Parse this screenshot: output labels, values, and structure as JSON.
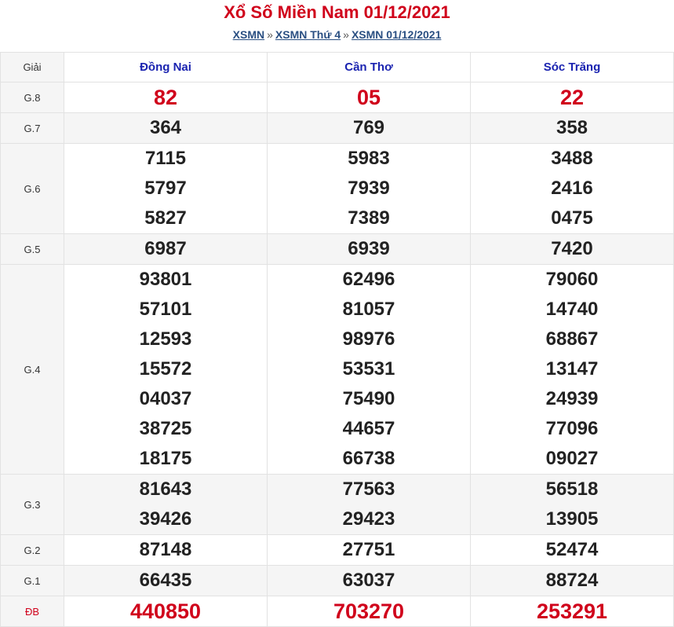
{
  "header": {
    "title": "Xổ Số Miền Nam 01/12/2021",
    "breadcrumb": [
      "XSMN",
      "XSMN Thứ 4",
      "XSMN 01/12/2021"
    ],
    "separator": "»"
  },
  "table": {
    "label_header": "Giải",
    "provinces": [
      "Đồng Nai",
      "Cần Thơ",
      "Sóc Trăng"
    ],
    "rows": [
      {
        "prize": "G.8",
        "values": [
          [
            "82"
          ],
          [
            "05"
          ],
          [
            "22"
          ]
        ]
      },
      {
        "prize": "G.7",
        "values": [
          [
            "364"
          ],
          [
            "769"
          ],
          [
            "358"
          ]
        ]
      },
      {
        "prize": "G.6",
        "values": [
          [
            "7115",
            "5797",
            "5827"
          ],
          [
            "5983",
            "7939",
            "7389"
          ],
          [
            "3488",
            "2416",
            "0475"
          ]
        ]
      },
      {
        "prize": "G.5",
        "values": [
          [
            "6987"
          ],
          [
            "6939"
          ],
          [
            "7420"
          ]
        ]
      },
      {
        "prize": "G.4",
        "values": [
          [
            "93801",
            "57101",
            "12593",
            "15572",
            "04037",
            "38725",
            "18175"
          ],
          [
            "62496",
            "81057",
            "98976",
            "53531",
            "75490",
            "44657",
            "66738"
          ],
          [
            "79060",
            "14740",
            "68867",
            "13147",
            "24939",
            "77096",
            "09027"
          ]
        ]
      },
      {
        "prize": "G.3",
        "values": [
          [
            "81643",
            "39426"
          ],
          [
            "77563",
            "29423"
          ],
          [
            "56518",
            "13905"
          ]
        ]
      },
      {
        "prize": "G.2",
        "values": [
          [
            "87148"
          ],
          [
            "27751"
          ],
          [
            "52474"
          ]
        ]
      },
      {
        "prize": "G.1",
        "values": [
          [
            "66435"
          ],
          [
            "63037"
          ],
          [
            "88724"
          ]
        ]
      },
      {
        "prize": "ĐB",
        "values": [
          [
            "440850"
          ],
          [
            "703270"
          ],
          [
            "253291"
          ]
        ]
      }
    ]
  },
  "colors": {
    "title": "#d0021b",
    "province": "#1a23b0",
    "link": "#2a4f82",
    "highlight": "#d0021b",
    "alt_row": "#f5f5f5"
  }
}
